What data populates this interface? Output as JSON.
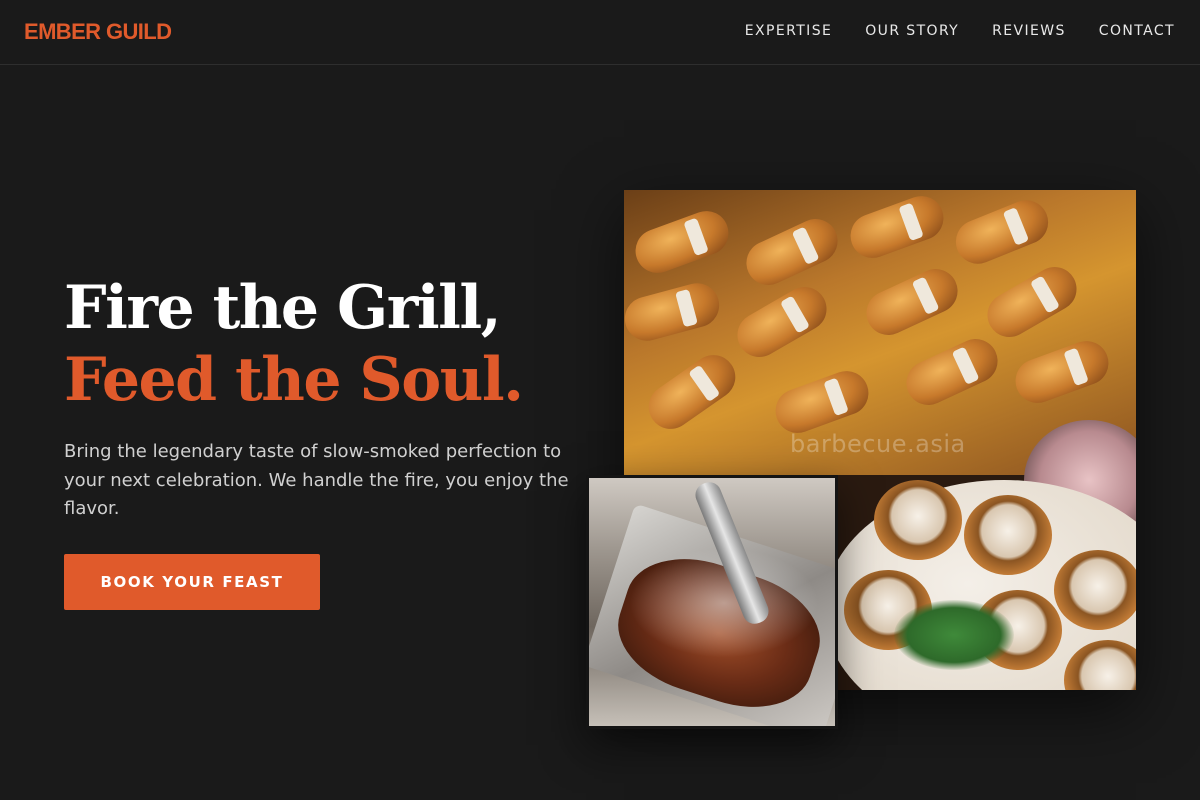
{
  "header": {
    "logo": "EMBER GUILD",
    "nav": [
      {
        "label": "EXPERTISE"
      },
      {
        "label": "OUR STORY"
      },
      {
        "label": "REVIEWS"
      },
      {
        "label": "CONTACT"
      }
    ]
  },
  "hero": {
    "title_line1": "Fire the Grill,",
    "title_line2": "Feed the Soul.",
    "subtitle": "Bring the legendary taste of slow-smoked perfection to your next celebration. We handle the fire, you enjoy the flavor.",
    "cta_label": "BOOK YOUR FEAST"
  },
  "gallery": {
    "watermark": "barbecue.asia"
  },
  "colors": {
    "accent": "#e05a2b",
    "background": "#1a1a1a",
    "text": "#ffffff"
  }
}
